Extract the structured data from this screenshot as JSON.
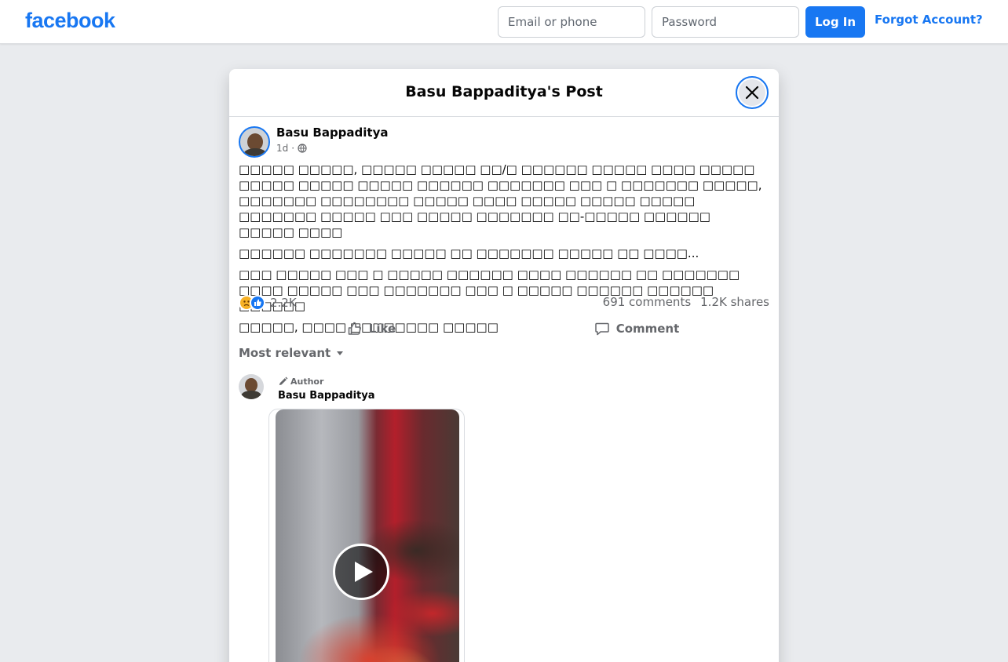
{
  "topbar": {
    "logo": "facebook",
    "email_placeholder": "Email or phone",
    "password_placeholder": "Password",
    "login_label": "Log In",
    "forgot_label": "Forgot Account?"
  },
  "modal": {
    "title": "Basu Bappaditya's Post",
    "close_icon": "close-icon"
  },
  "post": {
    "author": "Basu Bappaditya",
    "time": "1d",
    "separator": "·",
    "privacy_icon": "globe-icon",
    "paragraphs": [
      "□□□□□ □□□□□, □□□□□ □□□□□ □□/□ □□□□□□ □□□□□ □□□□ □□□□□ □□□□□ □□□□□ □□□□□ □□□□□□ □□□□□□□ □□□ □ □□□□□□□ □□□□□, □□□□□□□ □□□□□□□□ □□□□□ □□□□ □□□□□ □□□□□ □□□□□ □□□□□□□ □□□□□ □□□ □□□□□ □□□□□□□ □□-□□□□□ □□□□□□ □□□□□ □□□□",
      "□□□□□□ □□□□□□□ □□□□□ □□ □□□□□□□ □□□□□ □□ □□□□...",
      "□□□ □□□□□ □□□ □ □□□□□ □□□□□□ □□□□ □□□□□□ □□ □□□□□□□ □□□□ □□□□□ □□□ □□□□□□□ □□□ □ □□□□□ □□□□□□ □□□□□□ □□□□□□",
      "□□□□□, □□□□ □□□□□□□□ □□□□□"
    ],
    "reaction_icons": [
      "sad-reaction-icon",
      "like-reaction-icon"
    ],
    "reaction_count": "2.2K",
    "comments_count": "691 comments",
    "shares_count": "1.2K shares",
    "like_label": "Like",
    "comment_label": "Comment"
  },
  "comments": {
    "sort_label": "Most relevant",
    "items": [
      {
        "badge": "Author",
        "name": "Basu Bappaditya",
        "attachment": "video",
        "play_icon": "play-icon"
      }
    ]
  }
}
